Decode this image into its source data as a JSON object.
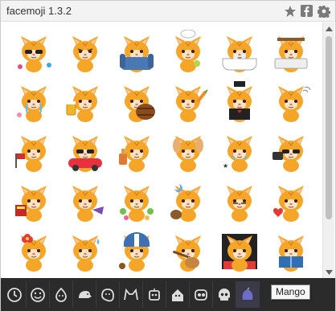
{
  "window": {
    "title": "facemoji 1.3.2"
  },
  "titlebar_icons": [
    "star-icon",
    "facebook-icon",
    "gear-icon"
  ],
  "stickers": [
    {
      "name": "cat-sunglasses"
    },
    {
      "name": "cat-grumpy"
    },
    {
      "name": "cat-armchair"
    },
    {
      "name": "cat-chef"
    },
    {
      "name": "cat-bathtub"
    },
    {
      "name": "cat-bed"
    },
    {
      "name": "cat-crying"
    },
    {
      "name": "cat-beer"
    },
    {
      "name": "cat-barrel"
    },
    {
      "name": "cat-carrot"
    },
    {
      "name": "cat-tuxedo"
    },
    {
      "name": "cat-wave"
    },
    {
      "name": "cat-flag"
    },
    {
      "name": "cat-car"
    },
    {
      "name": "cat-drink"
    },
    {
      "name": "cat-dog-ears"
    },
    {
      "name": "cat-sad"
    },
    {
      "name": "cat-cup"
    },
    {
      "name": "cat-flag-red"
    },
    {
      "name": "cat-horn"
    },
    {
      "name": "cat-sick"
    },
    {
      "name": "cat-moon"
    },
    {
      "name": "cat-shy"
    },
    {
      "name": "cat-heart"
    },
    {
      "name": "cat-flower"
    },
    {
      "name": "cat-sweat"
    },
    {
      "name": "cat-helmet"
    },
    {
      "name": "cat-guitar"
    },
    {
      "name": "cat-shock"
    },
    {
      "name": "cat-book"
    }
  ],
  "bottom_tabs": [
    {
      "icon": "clock-icon"
    },
    {
      "icon": "smiley-icon"
    },
    {
      "icon": "onion-icon"
    },
    {
      "icon": "hedgehog-icon"
    },
    {
      "icon": "blob-icon"
    },
    {
      "icon": "cat-outline-icon"
    },
    {
      "icon": "robot-icon"
    },
    {
      "icon": "house-icon"
    },
    {
      "icon": "monster-icon"
    },
    {
      "icon": "skull-icon"
    },
    {
      "icon": "mango-icon",
      "active": true
    }
  ],
  "tooltip": {
    "text": "Mango"
  },
  "colors": {
    "cat_fur": "#f5a628",
    "bottom_bar": "#2b2b2b"
  }
}
